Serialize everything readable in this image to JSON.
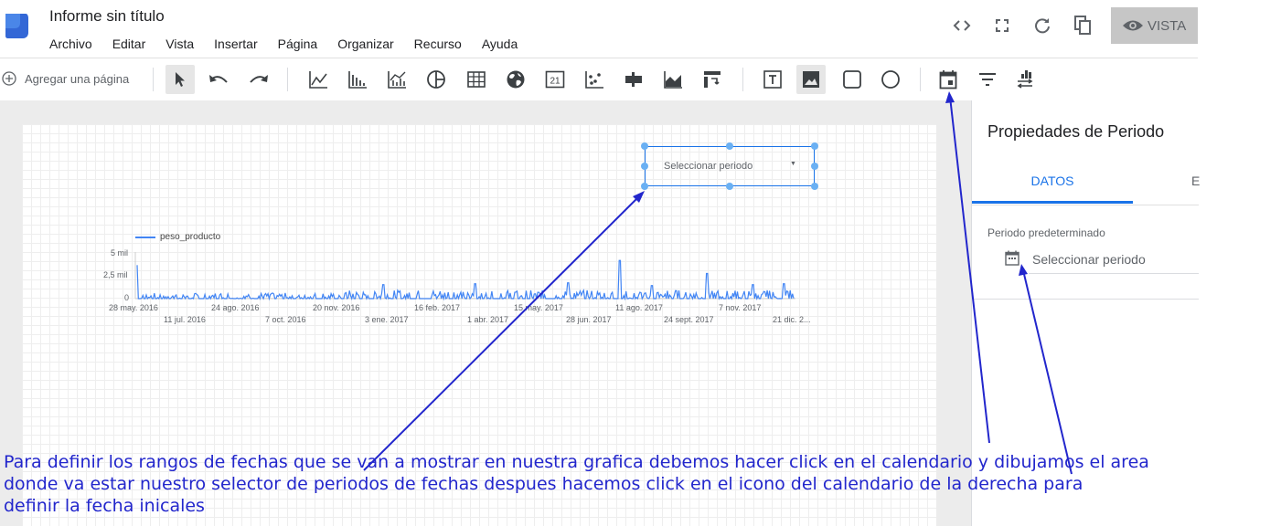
{
  "app": {
    "title": "Informe sin título"
  },
  "menu": [
    "Archivo",
    "Editar",
    "Vista",
    "Insertar",
    "Página",
    "Organizar",
    "Recurso",
    "Ayuda"
  ],
  "top_actions": {
    "icons": [
      "embed-code-icon",
      "fullscreen-icon",
      "refresh-icon",
      "copy-icon"
    ],
    "view_label": "VISTA"
  },
  "toolbar": {
    "add_page_label": "Agregar una página",
    "selected_tool": "image",
    "date_picker_tool_number": "21"
  },
  "date_control": {
    "placeholder": "Seleccionar periodo"
  },
  "chart": {
    "legend": "peso_producto",
    "y_ticks": [
      "5 mil",
      "2,5 mil",
      "0"
    ],
    "x_ticks_row1": [
      "28 may. 2016",
      "24 ago. 2016",
      "20 nov. 2016",
      "16 feb. 2017",
      "15 may. 2017",
      "11 ago. 2017",
      "7 nov. 2017"
    ],
    "x_ticks_row2": [
      "11 jul. 2016",
      "7 oct. 2016",
      "3 ene. 2017",
      "1 abr. 2017",
      "28 jun. 2017",
      "24 sept. 2017",
      "21 dic. 2..."
    ]
  },
  "chart_data": {
    "type": "line",
    "series": [
      {
        "name": "peso_producto"
      }
    ],
    "x_start": "28 may. 2016",
    "x_end": "21 dic. 2017",
    "ylim": [
      0,
      5000
    ],
    "y_ticks": [
      0,
      2500,
      5000
    ],
    "grid": false,
    "legend_position": "top-left",
    "color": "#4285f4"
  },
  "panel": {
    "title": "Propiedades de Periodo",
    "tabs": [
      "DATOS",
      "E"
    ],
    "default_period_label": "Periodo predeterminado",
    "default_period_value": "Seleccionar periodo"
  },
  "annotation": {
    "lines": [
      "Para definir los rangos de fechas que se van a mostrar en nuestra grafica debemos hacer click en el calendario y dibujamos el area",
      "donde va estar nuestro selector de periodos de fechas despues hacemos click en el icono del calendario de la derecha para",
      "definir la fecha inicales"
    ],
    "color": "#2226cc"
  },
  "colors": {
    "accent": "#1a73e8",
    "series": "#4285f4",
    "annotation": "#2226cc"
  }
}
